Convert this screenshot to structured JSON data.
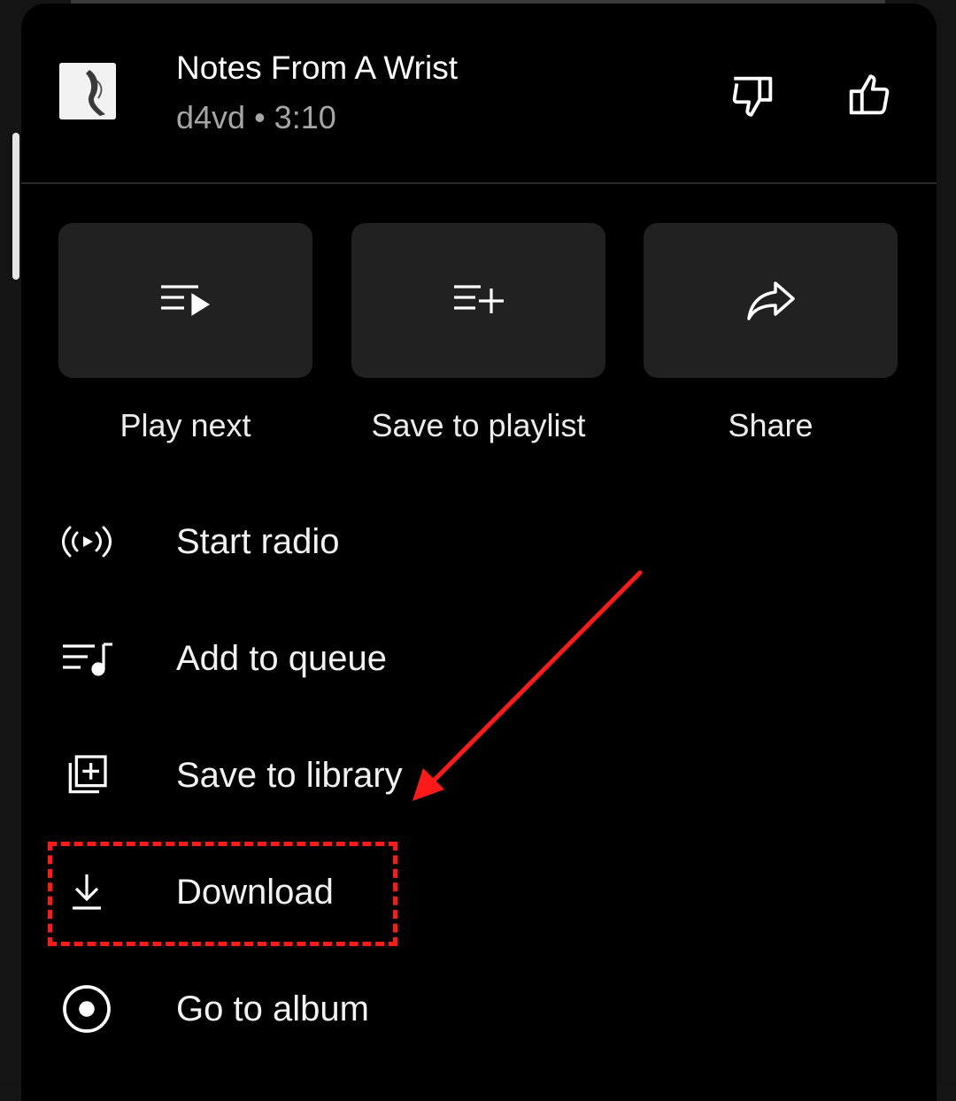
{
  "song": {
    "title": "Notes From A Wrist",
    "meta": "d4vd • 3:10"
  },
  "header_icons": {
    "dislike": "thumbs-down-icon",
    "like": "thumbs-up-icon"
  },
  "actions": [
    {
      "label": "Play next",
      "icon": "play-next-icon"
    },
    {
      "label": "Save to playlist",
      "icon": "playlist-add-icon"
    },
    {
      "label": "Share",
      "icon": "share-icon"
    }
  ],
  "menu": [
    {
      "label": "Start radio",
      "icon": "radio-icon"
    },
    {
      "label": "Add to queue",
      "icon": "queue-music-icon"
    },
    {
      "label": "Save to library",
      "icon": "library-add-icon"
    },
    {
      "label": "Download",
      "icon": "download-icon"
    },
    {
      "label": "Go to album",
      "icon": "album-icon"
    }
  ],
  "annotation": {
    "color": "#ff1a1a",
    "target": "Download"
  }
}
